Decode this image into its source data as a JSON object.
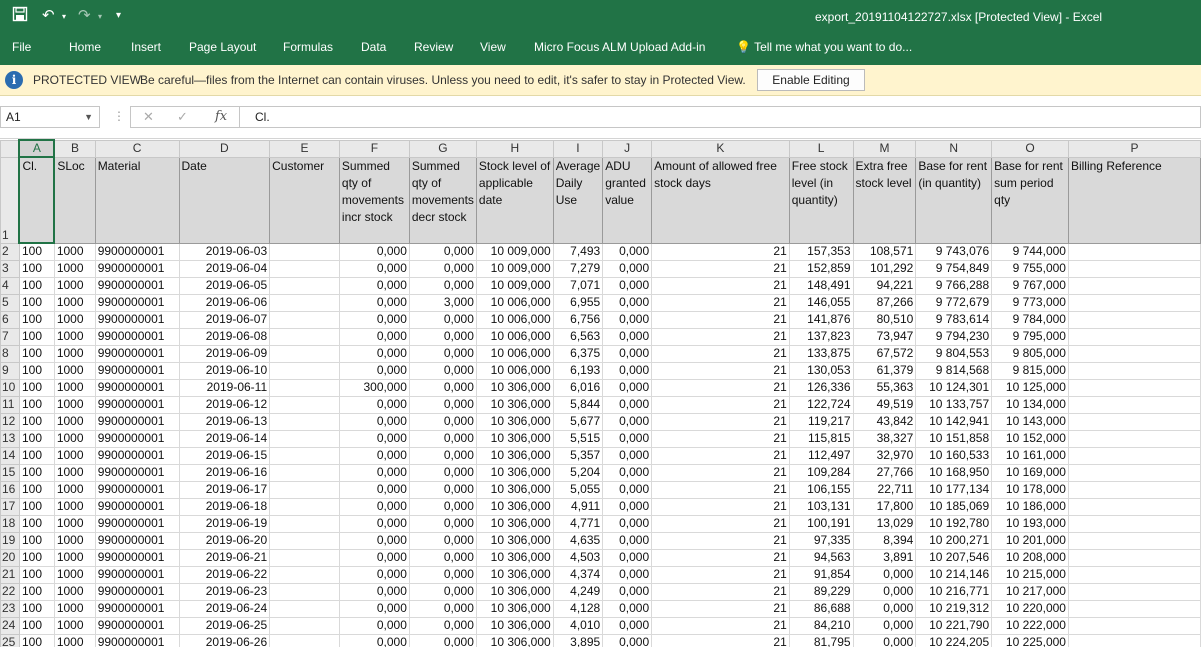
{
  "titlebar": {
    "title": "export_20191104122727.xlsx  [Protected View] - Excel",
    "save_icon": "save-icon",
    "undo_icon": "undo-icon",
    "redo_icon": "redo-icon",
    "customize_icon": "customize-quick-access-icon"
  },
  "ribbon": {
    "tabs": [
      "File",
      "Home",
      "Insert",
      "Page Layout",
      "Formulas",
      "Data",
      "Review",
      "View",
      "Micro Focus ALM Upload Add-in"
    ],
    "tellme": "Tell me what you want to do..."
  },
  "protected_view": {
    "title": "PROTECTED VIEW",
    "message": "Be careful—files from the Internet can contain viruses. Unless you need to edit, it's safer to stay in Protected View.",
    "button": "Enable Editing"
  },
  "formula_bar": {
    "name_box": "A1",
    "cancel_icon": "✕",
    "enter_icon": "✓",
    "fx_label": "fx",
    "formula": "Cl."
  },
  "colors": {
    "excel_green": "#217346",
    "warning_bg": "#fff4ce",
    "header_fill": "#d9d9d9"
  },
  "sheet": {
    "column_letters": [
      "A",
      "B",
      "C",
      "D",
      "E",
      "F",
      "G",
      "H",
      "I",
      "J",
      "K",
      "L",
      "M",
      "N",
      "O",
      "P"
    ],
    "header_row_number": "1",
    "headers": [
      "Cl.",
      "SLoc",
      "Material",
      "Date",
      "Customer",
      "Summed qty of movements incr stock",
      "Summed qty of movements decr stock",
      "Stock level of applicable date",
      "Average Daily Use",
      "ADU granted value",
      "Amount of allowed free stock days",
      "Free stock level (in quantity)",
      "Extra free stock level",
      "Base for rent (in quantity)",
      "Base for rent sum period qty",
      "Billing Reference"
    ],
    "rows": [
      {
        "n": "2",
        "c": [
          "100",
          "1000",
          "9900000001",
          "2019-06-03",
          "",
          "0,000",
          "0,000",
          "10 009,000",
          "7,493",
          "0,000",
          "21",
          "157,353",
          "108,571",
          "9 743,076",
          "9 744,000",
          ""
        ]
      },
      {
        "n": "3",
        "c": [
          "100",
          "1000",
          "9900000001",
          "2019-06-04",
          "",
          "0,000",
          "0,000",
          "10 009,000",
          "7,279",
          "0,000",
          "21",
          "152,859",
          "101,292",
          "9 754,849",
          "9 755,000",
          ""
        ]
      },
      {
        "n": "4",
        "c": [
          "100",
          "1000",
          "9900000001",
          "2019-06-05",
          "",
          "0,000",
          "0,000",
          "10 009,000",
          "7,071",
          "0,000",
          "21",
          "148,491",
          "94,221",
          "9 766,288",
          "9 767,000",
          ""
        ]
      },
      {
        "n": "5",
        "c": [
          "100",
          "1000",
          "9900000001",
          "2019-06-06",
          "",
          "0,000",
          "3,000",
          "10 006,000",
          "6,955",
          "0,000",
          "21",
          "146,055",
          "87,266",
          "9 772,679",
          "9 773,000",
          ""
        ]
      },
      {
        "n": "6",
        "c": [
          "100",
          "1000",
          "9900000001",
          "2019-06-07",
          "",
          "0,000",
          "0,000",
          "10 006,000",
          "6,756",
          "0,000",
          "21",
          "141,876",
          "80,510",
          "9 783,614",
          "9 784,000",
          ""
        ]
      },
      {
        "n": "7",
        "c": [
          "100",
          "1000",
          "9900000001",
          "2019-06-08",
          "",
          "0,000",
          "0,000",
          "10 006,000",
          "6,563",
          "0,000",
          "21",
          "137,823",
          "73,947",
          "9 794,230",
          "9 795,000",
          ""
        ]
      },
      {
        "n": "8",
        "c": [
          "100",
          "1000",
          "9900000001",
          "2019-06-09",
          "",
          "0,000",
          "0,000",
          "10 006,000",
          "6,375",
          "0,000",
          "21",
          "133,875",
          "67,572",
          "9 804,553",
          "9 805,000",
          ""
        ]
      },
      {
        "n": "9",
        "c": [
          "100",
          "1000",
          "9900000001",
          "2019-06-10",
          "",
          "0,000",
          "0,000",
          "10 006,000",
          "6,193",
          "0,000",
          "21",
          "130,053",
          "61,379",
          "9 814,568",
          "9 815,000",
          ""
        ]
      },
      {
        "n": "10",
        "c": [
          "100",
          "1000",
          "9900000001",
          "2019-06-11",
          "",
          "300,000",
          "0,000",
          "10 306,000",
          "6,016",
          "0,000",
          "21",
          "126,336",
          "55,363",
          "10 124,301",
          "10 125,000",
          ""
        ]
      },
      {
        "n": "11",
        "c": [
          "100",
          "1000",
          "9900000001",
          "2019-06-12",
          "",
          "0,000",
          "0,000",
          "10 306,000",
          "5,844",
          "0,000",
          "21",
          "122,724",
          "49,519",
          "10 133,757",
          "10 134,000",
          ""
        ]
      },
      {
        "n": "12",
        "c": [
          "100",
          "1000",
          "9900000001",
          "2019-06-13",
          "",
          "0,000",
          "0,000",
          "10 306,000",
          "5,677",
          "0,000",
          "21",
          "119,217",
          "43,842",
          "10 142,941",
          "10 143,000",
          ""
        ]
      },
      {
        "n": "13",
        "c": [
          "100",
          "1000",
          "9900000001",
          "2019-06-14",
          "",
          "0,000",
          "0,000",
          "10 306,000",
          "5,515",
          "0,000",
          "21",
          "115,815",
          "38,327",
          "10 151,858",
          "10 152,000",
          ""
        ]
      },
      {
        "n": "14",
        "c": [
          "100",
          "1000",
          "9900000001",
          "2019-06-15",
          "",
          "0,000",
          "0,000",
          "10 306,000",
          "5,357",
          "0,000",
          "21",
          "112,497",
          "32,970",
          "10 160,533",
          "10 161,000",
          ""
        ]
      },
      {
        "n": "15",
        "c": [
          "100",
          "1000",
          "9900000001",
          "2019-06-16",
          "",
          "0,000",
          "0,000",
          "10 306,000",
          "5,204",
          "0,000",
          "21",
          "109,284",
          "27,766",
          "10 168,950",
          "10 169,000",
          ""
        ]
      },
      {
        "n": "16",
        "c": [
          "100",
          "1000",
          "9900000001",
          "2019-06-17",
          "",
          "0,000",
          "0,000",
          "10 306,000",
          "5,055",
          "0,000",
          "21",
          "106,155",
          "22,711",
          "10 177,134",
          "10 178,000",
          ""
        ]
      },
      {
        "n": "17",
        "c": [
          "100",
          "1000",
          "9900000001",
          "2019-06-18",
          "",
          "0,000",
          "0,000",
          "10 306,000",
          "4,911",
          "0,000",
          "21",
          "103,131",
          "17,800",
          "10 185,069",
          "10 186,000",
          ""
        ]
      },
      {
        "n": "18",
        "c": [
          "100",
          "1000",
          "9900000001",
          "2019-06-19",
          "",
          "0,000",
          "0,000",
          "10 306,000",
          "4,771",
          "0,000",
          "21",
          "100,191",
          "13,029",
          "10 192,780",
          "10 193,000",
          ""
        ]
      },
      {
        "n": "19",
        "c": [
          "100",
          "1000",
          "9900000001",
          "2019-06-20",
          "",
          "0,000",
          "0,000",
          "10 306,000",
          "4,635",
          "0,000",
          "21",
          "97,335",
          "8,394",
          "10 200,271",
          "10 201,000",
          ""
        ]
      },
      {
        "n": "20",
        "c": [
          "100",
          "1000",
          "9900000001",
          "2019-06-21",
          "",
          "0,000",
          "0,000",
          "10 306,000",
          "4,503",
          "0,000",
          "21",
          "94,563",
          "3,891",
          "10 207,546",
          "10 208,000",
          ""
        ]
      },
      {
        "n": "21",
        "c": [
          "100",
          "1000",
          "9900000001",
          "2019-06-22",
          "",
          "0,000",
          "0,000",
          "10 306,000",
          "4,374",
          "0,000",
          "21",
          "91,854",
          "0,000",
          "10 214,146",
          "10 215,000",
          ""
        ]
      },
      {
        "n": "22",
        "c": [
          "100",
          "1000",
          "9900000001",
          "2019-06-23",
          "",
          "0,000",
          "0,000",
          "10 306,000",
          "4,249",
          "0,000",
          "21",
          "89,229",
          "0,000",
          "10 216,771",
          "10 217,000",
          ""
        ]
      },
      {
        "n": "23",
        "c": [
          "100",
          "1000",
          "9900000001",
          "2019-06-24",
          "",
          "0,000",
          "0,000",
          "10 306,000",
          "4,128",
          "0,000",
          "21",
          "86,688",
          "0,000",
          "10 219,312",
          "10 220,000",
          ""
        ]
      },
      {
        "n": "24",
        "c": [
          "100",
          "1000",
          "9900000001",
          "2019-06-25",
          "",
          "0,000",
          "0,000",
          "10 306,000",
          "4,010",
          "0,000",
          "21",
          "84,210",
          "0,000",
          "10 221,790",
          "10 222,000",
          ""
        ]
      },
      {
        "n": "25",
        "c": [
          "100",
          "1000",
          "9900000001",
          "2019-06-26",
          "",
          "0,000",
          "0,000",
          "10 306,000",
          "3,895",
          "0,000",
          "21",
          "81,795",
          "0,000",
          "10 224,205",
          "10 225,000",
          ""
        ]
      }
    ]
  }
}
